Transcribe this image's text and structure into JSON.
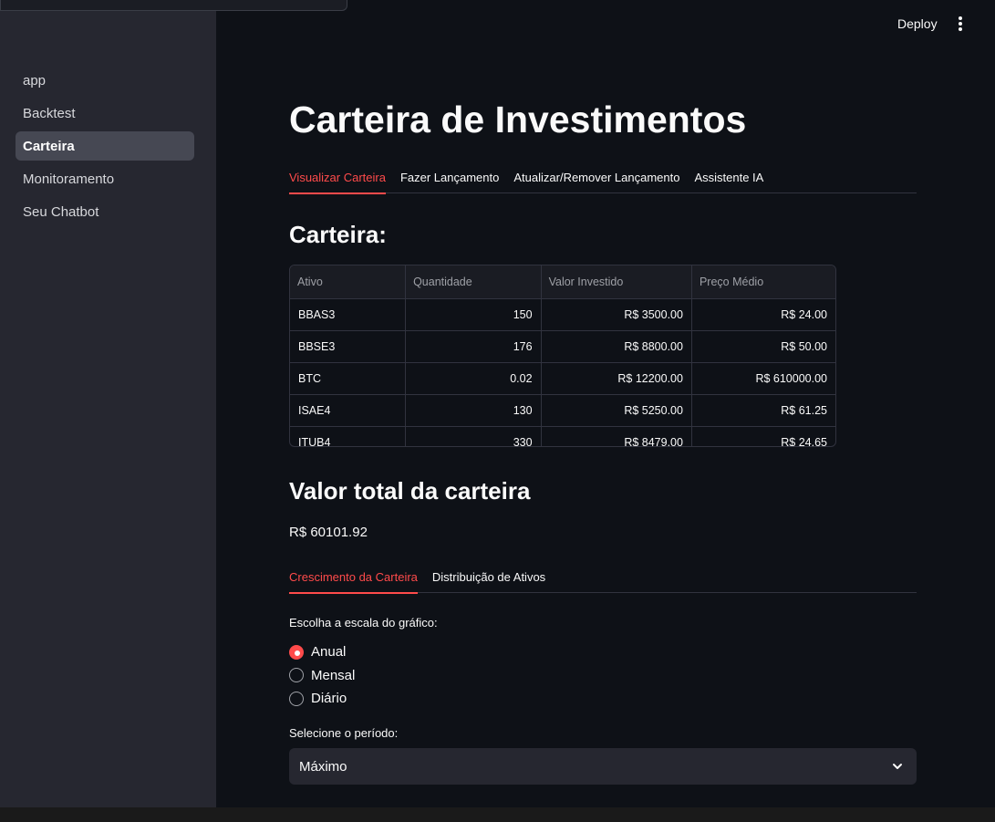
{
  "header": {
    "deploy_label": "Deploy"
  },
  "sidebar": {
    "items": [
      {
        "label": "app"
      },
      {
        "label": "Backtest"
      },
      {
        "label": "Carteira"
      },
      {
        "label": "Monitoramento"
      },
      {
        "label": "Seu Chatbot"
      }
    ],
    "active_item": "Carteira"
  },
  "main": {
    "title": "Carteira de Investimentos",
    "tabs": [
      {
        "label": "Visualizar Carteira"
      },
      {
        "label": "Fazer Lançamento"
      },
      {
        "label": "Atualizar/Remover Lançamento"
      },
      {
        "label": "Assistente IA"
      }
    ],
    "active_tab": "Visualizar Carteira",
    "portfolio_heading": "Carteira:",
    "table": {
      "columns": [
        "Ativo",
        "Quantidade",
        "Valor Investido",
        "Preço Médio"
      ],
      "rows": [
        [
          "BBAS3",
          "150",
          "R$ 3500.00",
          "R$ 24.00"
        ],
        [
          "BBSE3",
          "176",
          "R$ 8800.00",
          "R$ 50.00"
        ],
        [
          "BTC",
          "0.02",
          "R$ 12200.00",
          "R$ 610000.00"
        ],
        [
          "ISAE4",
          "130",
          "R$ 5250.00",
          "R$ 61.25"
        ],
        [
          "ITUB4",
          "330",
          "R$ 8479.00",
          "R$ 24.65"
        ]
      ]
    },
    "total_heading": "Valor total da carteira",
    "total_value": "R$ 60101.92",
    "chart_tabs": [
      {
        "label": "Crescimento da Carteira"
      },
      {
        "label": "Distribuição de Ativos"
      }
    ],
    "active_chart_tab": "Crescimento da Carteira",
    "scale_label": "Escolha a escala do gráfico:",
    "scale_options": [
      {
        "label": "Anual",
        "checked": true
      },
      {
        "label": "Mensal",
        "checked": false
      },
      {
        "label": "Diário",
        "checked": false
      }
    ],
    "period_label": "Selecione o período:",
    "period_selected": "Máximo"
  },
  "colors": {
    "accent": "#ff4b4b",
    "background": "#0e1117",
    "sidebar": "#262730"
  }
}
